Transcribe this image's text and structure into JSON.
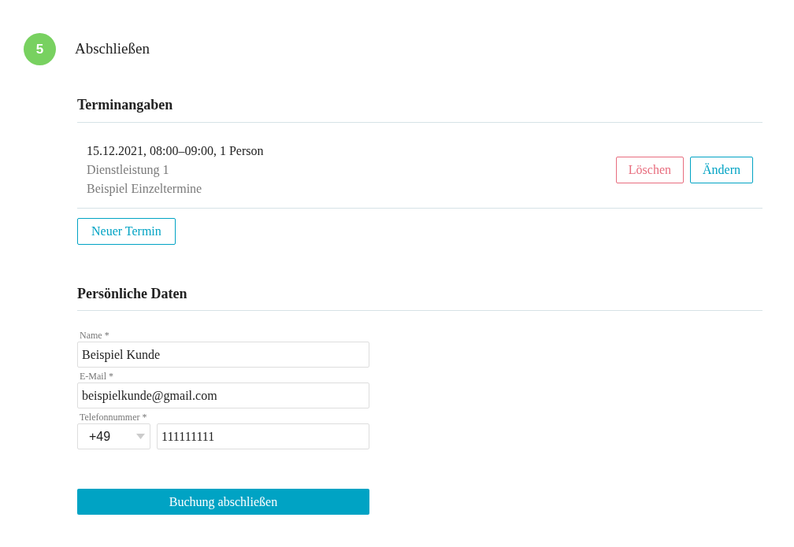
{
  "step": {
    "number": "5",
    "title": "Abschließen"
  },
  "appointments_section": {
    "heading": "Terminangaben",
    "appointments": [
      {
        "summary": "15.12.2021, 08:00–09:00, 1 Person",
        "service": "Dienstleistung 1",
        "calendar": "Beispiel Einzeltermine",
        "buttons": [
          {
            "label": "Löschen",
            "kind": "danger"
          },
          {
            "label": "Ändern",
            "kind": "primary"
          }
        ]
      }
    ],
    "new_button": "Neuer Termin"
  },
  "personal_section": {
    "heading": "Persönliche Daten",
    "fields": [
      {
        "label": "Name *",
        "value": "Beispiel Kunde",
        "kind": "text"
      },
      {
        "label": "E-Mail *",
        "value": "beispielkunde@gmail.com",
        "kind": "text"
      },
      {
        "label": "Telefonnummer *",
        "prefix": "+49",
        "value": "111111111",
        "kind": "phone"
      }
    ]
  },
  "submit_button": "Buchung abschließen"
}
